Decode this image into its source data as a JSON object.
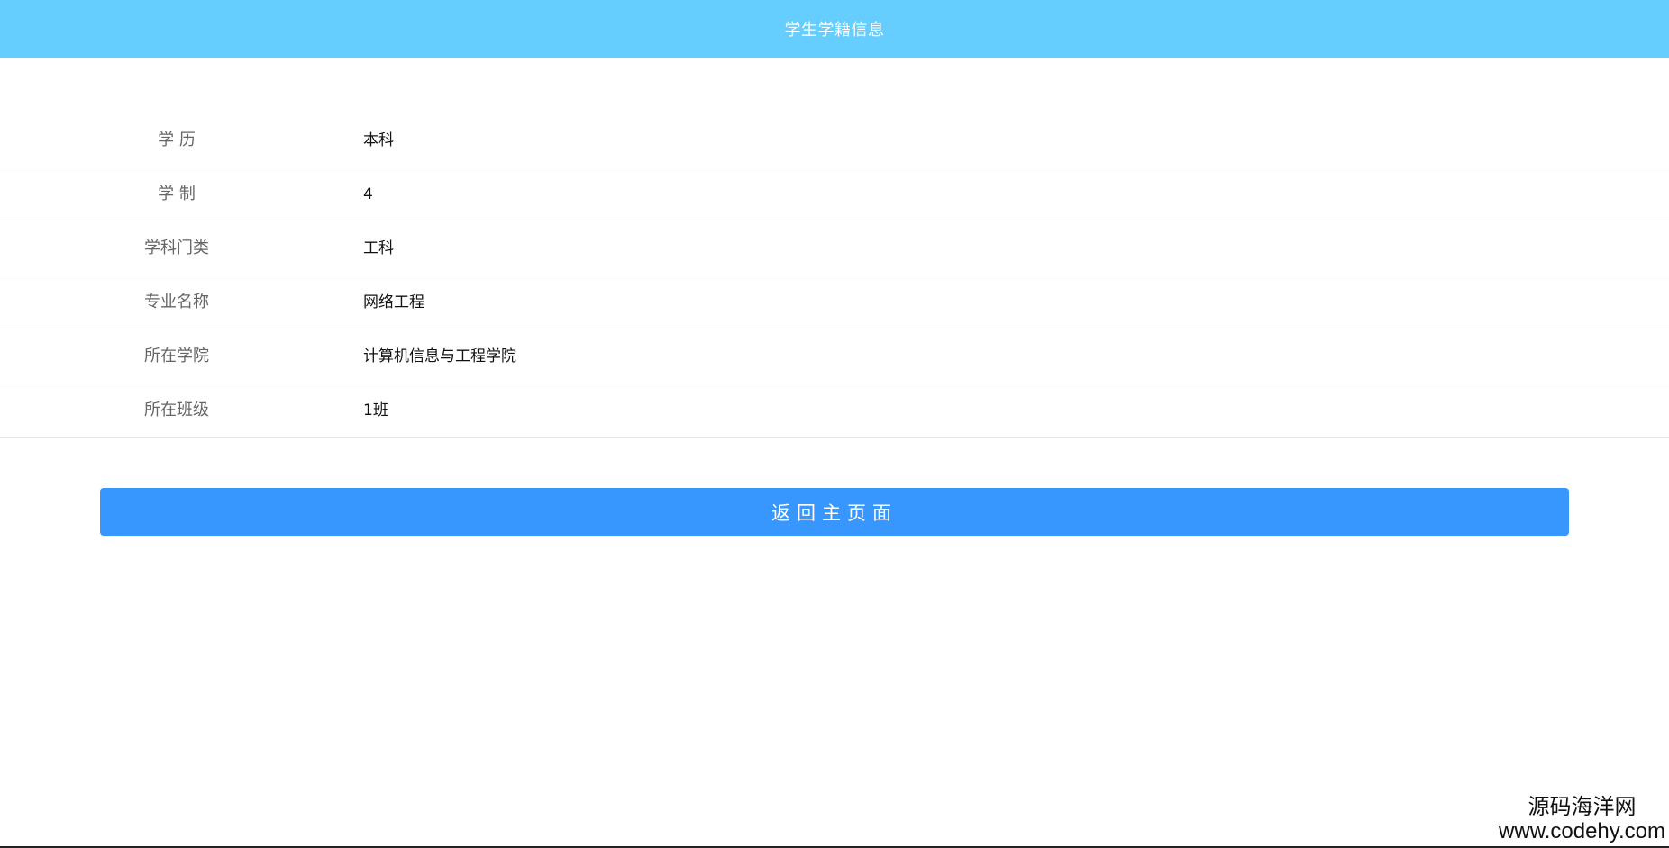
{
  "header": {
    "title": "学生学籍信息"
  },
  "info": {
    "rows": [
      {
        "label": "学 历",
        "value": "本科"
      },
      {
        "label": "学 制",
        "value": "4"
      },
      {
        "label": "学科门类",
        "value": "工科"
      },
      {
        "label": "专业名称",
        "value": "网络工程"
      },
      {
        "label": "所在学院",
        "value": "计算机信息与工程学院"
      },
      {
        "label": "所在班级",
        "value": "1班"
      }
    ]
  },
  "actions": {
    "back_label": "返回主页面"
  },
  "watermark": {
    "name": "源码海洋网",
    "url": "www.codehy.com"
  },
  "colors": {
    "header_bg": "#66cdff",
    "button_bg": "#3797ff",
    "divider": "#e5e5e5"
  }
}
